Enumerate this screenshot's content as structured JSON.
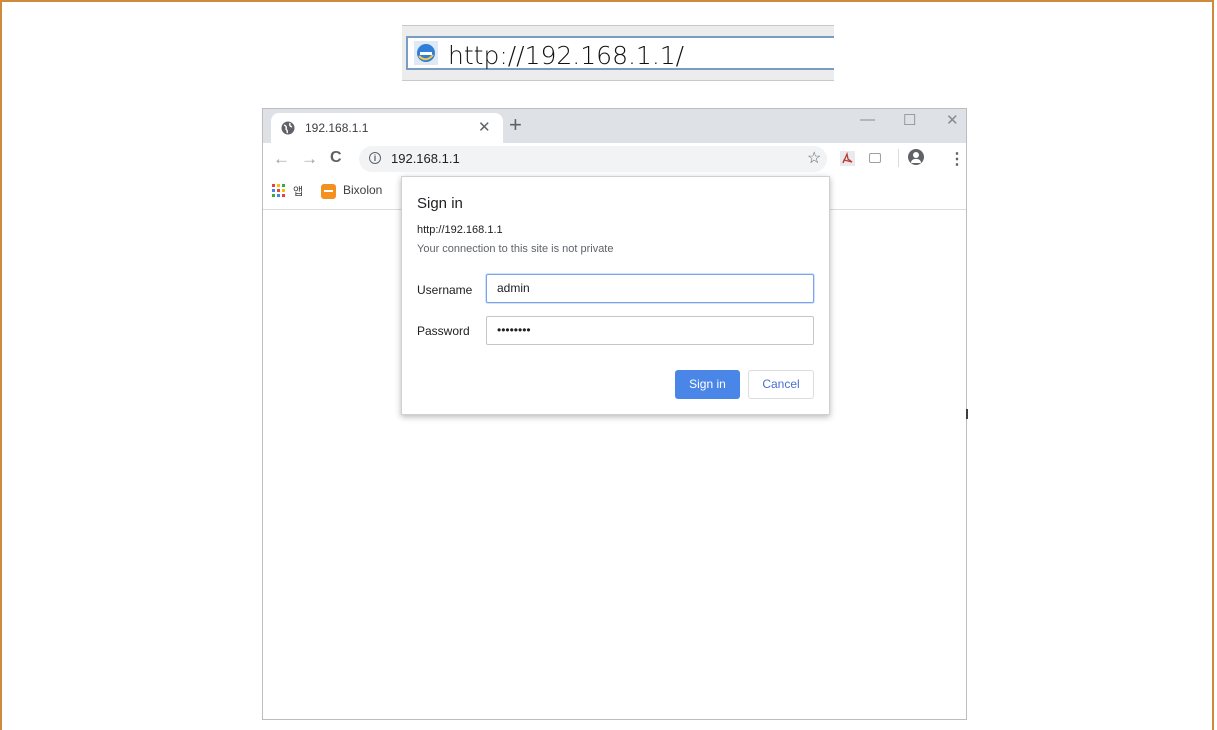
{
  "ie_address_bar": {
    "url": "http://192.168.1.1/"
  },
  "browser": {
    "tab": {
      "title": "192.168.1.1"
    },
    "window_controls": {
      "minimize": "—",
      "maximize": "☐",
      "close": "✕"
    },
    "omnibox": {
      "url": "192.168.1.1"
    },
    "bookmarks": {
      "apps_label": "앱",
      "items": [
        {
          "label": "Bixolon"
        }
      ]
    }
  },
  "dialog": {
    "title": "Sign in",
    "origin": "http://192.168.1.1",
    "warning": "Your connection to this site is not private",
    "username_label": "Username",
    "username_value": "admin",
    "password_label": "Password",
    "password_value": "••••••••",
    "signin_label": "Sign in",
    "cancel_label": "Cancel"
  },
  "colors": {
    "frame": "#d08a3c",
    "primary_button": "#4a86e8",
    "tabstrip": "#dee1e6",
    "bixolon": "#f39020"
  }
}
